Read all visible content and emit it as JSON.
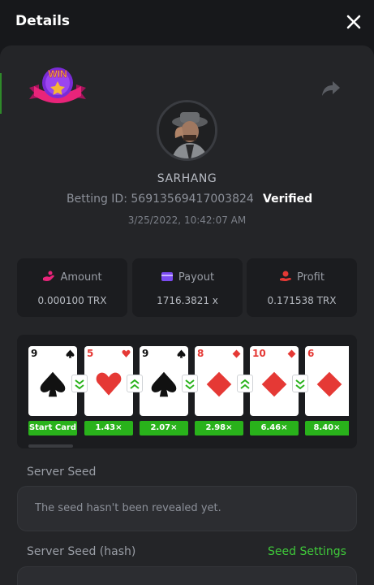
{
  "header": {
    "title": "Details"
  },
  "colors": {
    "accent_green": "#3fc93a",
    "multiplier_green": "#29b21b",
    "panel_bg": "#242528",
    "page_bg": "#17181b"
  },
  "icons": {
    "close": "close-icon",
    "share": "share-icon",
    "win": "win-badge-icon",
    "amount": "coins-icon",
    "payout": "wallet-icon",
    "profit": "hand-coin-icon"
  },
  "player": {
    "username": "SARHANG",
    "betting_id_label": "Betting ID:",
    "betting_id": "56913569417003824",
    "status": "Verified",
    "datetime": "3/25/2022, 10:42:07 AM"
  },
  "stats": {
    "amount_label": "Amount",
    "amount_value": "0.000100 TRX",
    "payout_label": "Payout",
    "payout_value": "1716.3821 x",
    "profit_label": "Profit",
    "profit_value": "0.171538 TRX"
  },
  "cards": [
    {
      "rank": "9",
      "suit": "spade",
      "color": "#111111"
    },
    {
      "rank": "5",
      "suit": "heart",
      "color": "#e53935"
    },
    {
      "rank": "9",
      "suit": "spade",
      "color": "#111111"
    },
    {
      "rank": "8",
      "suit": "diamond",
      "color": "#e53935"
    },
    {
      "rank": "10",
      "suit": "diamond",
      "color": "#e53935"
    },
    {
      "rank": "6",
      "suit": "diamond",
      "color": "#e53935"
    }
  ],
  "guesses": [
    "lower",
    "higher",
    "lower",
    "higher",
    "lower"
  ],
  "multipliers": [
    "Start Card",
    "1.43×",
    "2.07×",
    "2.98×",
    "6.46×",
    "8.40×"
  ],
  "seeds": {
    "server_seed_label": "Server Seed",
    "server_seed_value": "The seed hasn't been revealed yet.",
    "server_seed_hash_label": "Server Seed (hash)",
    "seed_settings_label": "Seed Settings"
  }
}
